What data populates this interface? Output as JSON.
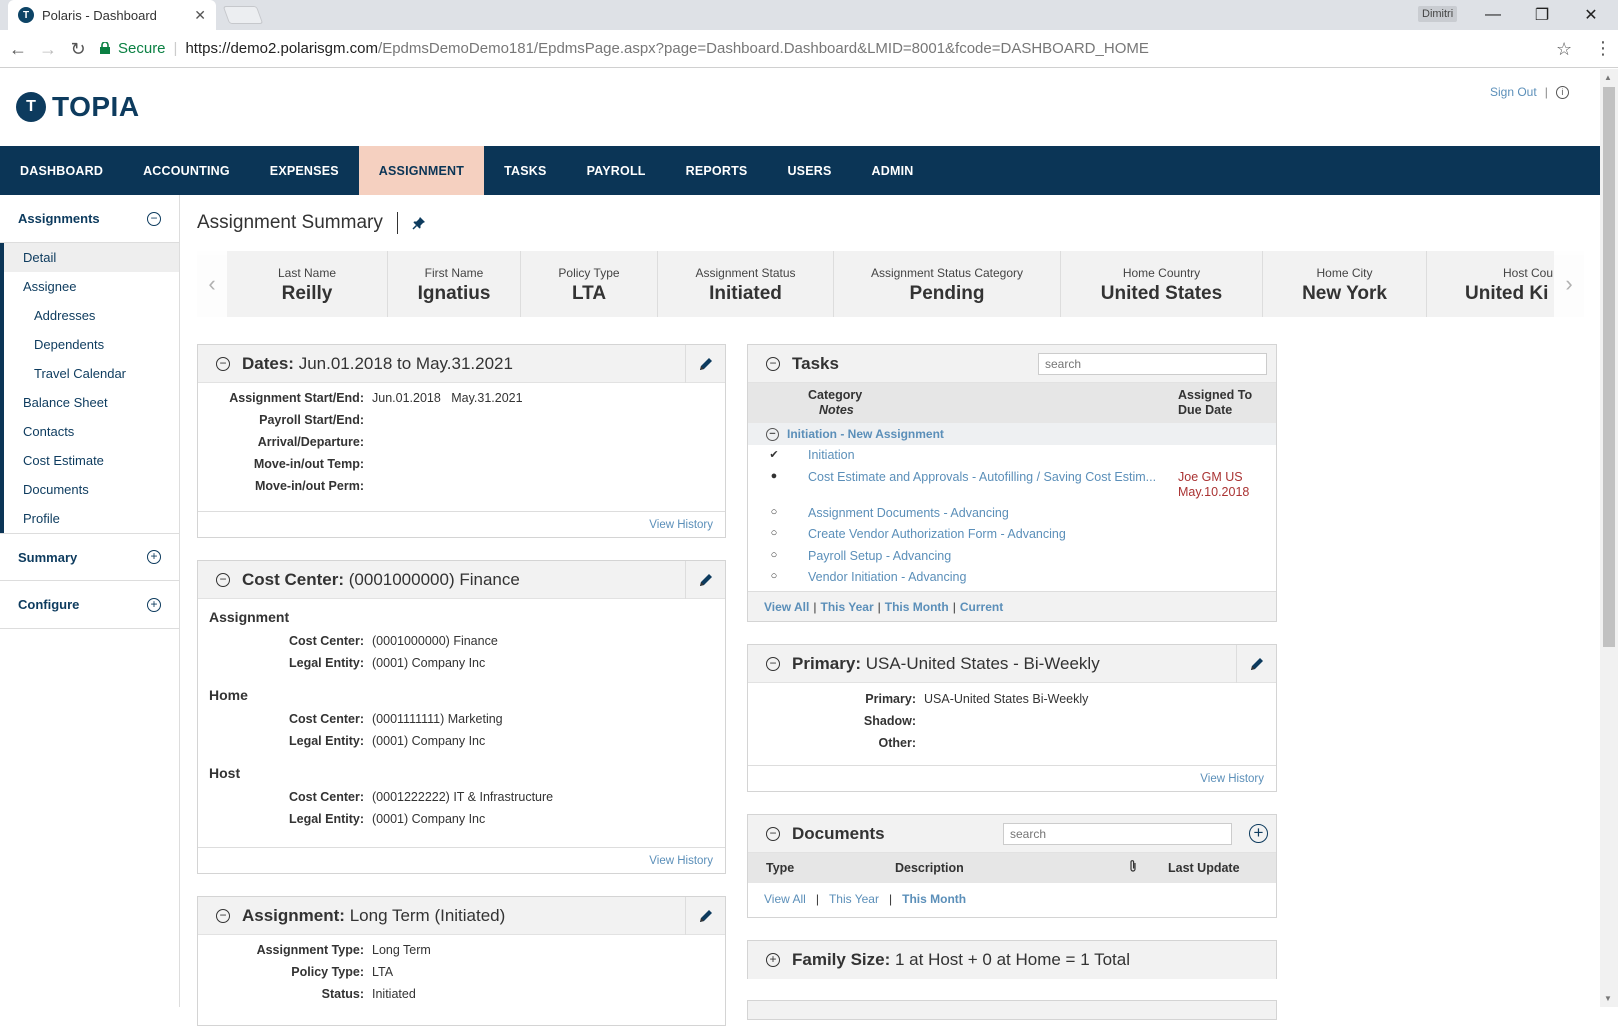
{
  "browser": {
    "tab_title": "Polaris - Dashboard",
    "tab_favicon": "T",
    "user": "Dimitri",
    "secure_label": "Secure",
    "url_host": "https://demo2.polarisgm.com",
    "url_path": "/EpdmsDemoDemo181/EpdmsPage.aspx?page=Dashboard.Dashboard&LMID=8001&fcode=DASHBOARD_HOME"
  },
  "header": {
    "logo_mark": "T",
    "logo_text": "TOPIA",
    "sign_out": "Sign Out",
    "info_icon": "i"
  },
  "nav": [
    "DASHBOARD",
    "ACCOUNTING",
    "EXPENSES",
    "ASSIGNMENT",
    "TASKS",
    "PAYROLL",
    "REPORTS",
    "USERS",
    "ADMIN"
  ],
  "nav_active": "ASSIGNMENT",
  "sidebar": {
    "sections": [
      {
        "label": "Assignments",
        "toggle": "−"
      },
      {
        "label": "Summary",
        "toggle": "+"
      },
      {
        "label": "Configure",
        "toggle": "+"
      }
    ],
    "items": [
      {
        "label": "Detail"
      },
      {
        "label": "Assignee"
      },
      {
        "label": "Addresses"
      },
      {
        "label": "Dependents"
      },
      {
        "label": "Travel Calendar"
      },
      {
        "label": "Balance Sheet"
      },
      {
        "label": "Contacts"
      },
      {
        "label": "Cost Estimate"
      },
      {
        "label": "Documents"
      },
      {
        "label": "Profile"
      }
    ]
  },
  "page_title": "Assignment Summary",
  "summary_strip": [
    {
      "label": "Last Name",
      "value": "Reilly"
    },
    {
      "label": "First Name",
      "value": "Ignatius"
    },
    {
      "label": "Policy Type",
      "value": "LTA"
    },
    {
      "label": "Assignment Status",
      "value": "Initiated"
    },
    {
      "label": "Assignment Status Category",
      "value": "Pending"
    },
    {
      "label": "Home Country",
      "value": "United States"
    },
    {
      "label": "Home City",
      "value": "New York"
    },
    {
      "label": "Host Cou",
      "value": "United Ki"
    }
  ],
  "dates_panel": {
    "title_bold": "Dates:",
    "title_rest": "Jun.01.2018 to May.31.2021",
    "rows": [
      {
        "k": "Assignment Start/End:",
        "v": "Jun.01.2018   May.31.2021"
      },
      {
        "k": "Payroll Start/End:",
        "v": ""
      },
      {
        "k": "Arrival/Departure:",
        "v": ""
      },
      {
        "k": "Move-in/out Temp:",
        "v": ""
      },
      {
        "k": "Move-in/out Perm:",
        "v": ""
      }
    ],
    "footer": "View History"
  },
  "cost_center_panel": {
    "title_bold": "Cost Center:",
    "title_rest": "(0001000000) Finance",
    "groups": [
      {
        "name": "Assignment",
        "rows": [
          {
            "k": "Cost Center:",
            "v": "(0001000000) Finance"
          },
          {
            "k": "Legal Entity:",
            "v": "(0001) Company Inc"
          }
        ]
      },
      {
        "name": "Home",
        "rows": [
          {
            "k": "Cost Center:",
            "v": "(0001111111) Marketing"
          },
          {
            "k": "Legal Entity:",
            "v": "(0001) Company Inc"
          }
        ]
      },
      {
        "name": "Host",
        "rows": [
          {
            "k": "Cost Center:",
            "v": "(0001222222) IT & Infrastructure"
          },
          {
            "k": "Legal Entity:",
            "v": "(0001) Company Inc"
          }
        ]
      }
    ],
    "footer": "View History"
  },
  "assignment_panel": {
    "title_bold": "Assignment:",
    "title_rest": "Long Term (Initiated)",
    "rows": [
      {
        "k": "Assignment Type:",
        "v": "Long Term"
      },
      {
        "k": "Policy Type:",
        "v": "LTA"
      },
      {
        "k": "Status:",
        "v": "Initiated"
      }
    ]
  },
  "tasks_panel": {
    "title": "Tasks",
    "search_placeholder": "search",
    "col_category": "Category",
    "col_notes": "Notes",
    "col_assigned": "Assigned To",
    "col_due": "Due Date",
    "group": "Initiation - New Assignment",
    "rows": [
      {
        "mark": "✔",
        "name": "Initiation",
        "assigned": "",
        "due": ""
      },
      {
        "mark": "●",
        "name": "Cost Estimate and Approvals - Autofilling / Saving Cost Estim...",
        "assigned": "Joe GM US",
        "due": "May.10.2018"
      },
      {
        "mark": "○",
        "name": "Assignment Documents - Advancing",
        "assigned": "",
        "due": ""
      },
      {
        "mark": "○",
        "name": "Create Vendor Authorization Form - Advancing",
        "assigned": "",
        "due": ""
      },
      {
        "mark": "○",
        "name": "Payroll Setup - Advancing",
        "assigned": "",
        "due": ""
      },
      {
        "mark": "○",
        "name": "Vendor Initiation - Advancing",
        "assigned": "",
        "due": ""
      }
    ],
    "footer": [
      "View All",
      "This Year",
      "This Month",
      "Current"
    ]
  },
  "primary_panel": {
    "title_bold": "Primary:",
    "title_rest": "USA-United States - Bi-Weekly",
    "rows": [
      {
        "k": "Primary:",
        "v": "USA-United States Bi-Weekly"
      },
      {
        "k": "Shadow:",
        "v": ""
      },
      {
        "k": "Other:",
        "v": ""
      }
    ],
    "footer": "View History"
  },
  "documents_panel": {
    "title": "Documents",
    "search_placeholder": "search",
    "cols": [
      "Type",
      "Description",
      "Last Update"
    ],
    "footer": [
      "View All",
      "This Year",
      "This Month"
    ]
  },
  "family_panel": {
    "title_bold": "Family Size:",
    "title_rest": "1 at Host + 0 at Home = 1 Total"
  },
  "colors": {
    "nav_bg": "#0b3556",
    "nav_active_bg": "#f5d0c0",
    "link": "#5b8fb9",
    "due": "#aa3333"
  }
}
